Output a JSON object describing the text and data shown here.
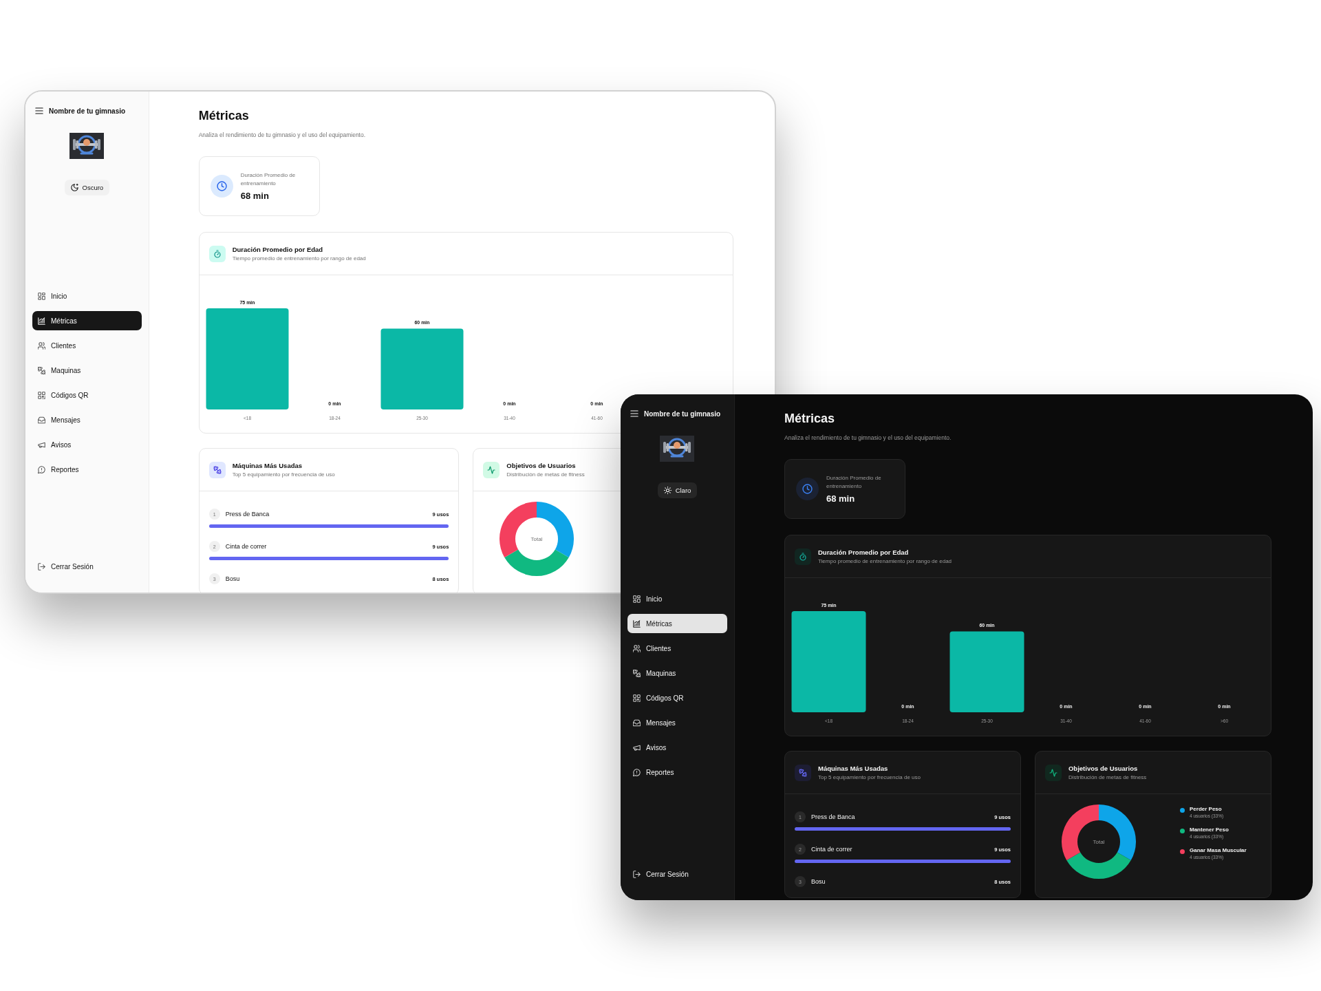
{
  "screens": [
    {
      "kind": "light",
      "sidebar": {
        "title": "Nombre de tu gimnasio",
        "theme_button": "Oscuro",
        "nav": [
          {
            "label": "Inicio",
            "selected": false
          },
          {
            "label": "Métricas",
            "selected": true
          },
          {
            "label": "Clientes",
            "selected": false
          },
          {
            "label": "Maquinas",
            "selected": false
          },
          {
            "label": "Códigos QR",
            "selected": false
          },
          {
            "label": "Mensajes",
            "selected": false
          },
          {
            "label": "Avisos",
            "selected": false
          },
          {
            "label": "Reportes",
            "selected": false
          }
        ],
        "logout": "Cerrar Sesión"
      },
      "header": {
        "title": "Métricas",
        "subtitle": "Analiza el rendimiento de tu gimnasio y el uso del equipamiento."
      },
      "stat_card": {
        "label": "Duración Promedio de entrenamiento",
        "value": "68 min"
      },
      "age_chart": {
        "title": "Duración Promedio por Edad",
        "subtitle": "Tiempo promedio de entrenamiento por rango de edad",
        "chart_data": {
          "type": "bar",
          "categories": [
            "<18",
            "18-24",
            "25-30",
            "31-40",
            "41-60"
          ],
          "values": [
            75,
            0,
            60,
            0,
            0
          ],
          "value_labels": [
            "75 min",
            "0 min",
            "60 min",
            "0 min",
            "0 min"
          ]
        }
      },
      "machines": {
        "title": "Máquinas Más Usadas",
        "subtitle": "Top 5 equipamiento por frecuencia de uso",
        "items": [
          {
            "rank": "1",
            "name": "Press de Banca",
            "count": "9 usos",
            "level": 1
          },
          {
            "rank": "2",
            "name": "Cinta de correr",
            "count": "9 usos",
            "level": 1
          },
          {
            "rank": "3",
            "name": "Bosu",
            "count": "8 usos"
          }
        ]
      },
      "goals": {
        "title": "Objetivos de Usuarios",
        "subtitle": "Distribución de metas de fitness",
        "center_label": "Total"
      }
    },
    {
      "kind": "dark",
      "sidebar": {
        "title": "Nombre de tu gimnasio",
        "theme_button": "Claro",
        "nav": [
          {
            "label": "Inicio",
            "selected": false
          },
          {
            "label": "Métricas",
            "selected": true
          },
          {
            "label": "Clientes",
            "selected": false
          },
          {
            "label": "Maquinas",
            "selected": false
          },
          {
            "label": "Códigos QR",
            "selected": false
          },
          {
            "label": "Mensajes",
            "selected": false
          },
          {
            "label": "Avisos",
            "selected": false
          },
          {
            "label": "Reportes",
            "selected": false
          }
        ],
        "logout": "Cerrar Sesión"
      },
      "header": {
        "title": "Métricas",
        "subtitle": "Analiza el rendimiento de tu gimnasio y el uso del equipamiento."
      },
      "stat_card": {
        "label": "Duración Promedio de entrenamiento",
        "value": "68 min"
      },
      "age_chart": {
        "title": "Duración Promedio por Edad",
        "subtitle": "Tiempo promedio de entrenamiento por rango de edad",
        "chart_data": {
          "type": "bar",
          "categories": [
            "<18",
            "18-24",
            "25-30",
            "31-40",
            "41-60",
            ">60"
          ],
          "values": [
            75,
            0,
            60,
            0,
            0,
            0
          ],
          "value_labels": [
            "75 min",
            "0 min",
            "60 min",
            "0 min",
            "0 min",
            "0 min"
          ]
        }
      },
      "machines": {
        "title": "Máquinas Más Usadas",
        "subtitle": "Top 5 equipamiento por frecuencia de uso",
        "items": [
          {
            "rank": "1",
            "name": "Press de Banca",
            "count": "9 usos",
            "level": 1
          },
          {
            "rank": "2",
            "name": "Cinta de correr",
            "count": "9 usos",
            "level": 1
          },
          {
            "rank": "3",
            "name": "Bosu",
            "count": "8 usos"
          }
        ]
      },
      "goals": {
        "title": "Objetivos de Usuarios",
        "subtitle": "Distribución de metas de fitness",
        "center_label": "Total",
        "chart_data": {
          "type": "donut",
          "categories": [
            "Perder Peso",
            "Mantener Peso",
            "Ganar Masa Muscular"
          ],
          "values": [
            33,
            33,
            33
          ]
        },
        "legend": [
          {
            "detail": "4 usuarios (33%)",
            "color": "#0ea5e9"
          },
          {
            "detail": "4 usuarios (33%)",
            "color": "#10b981"
          },
          {
            "detail": "4 usuarios (33%)",
            "color": "#f43f5e"
          }
        ]
      }
    }
  ]
}
